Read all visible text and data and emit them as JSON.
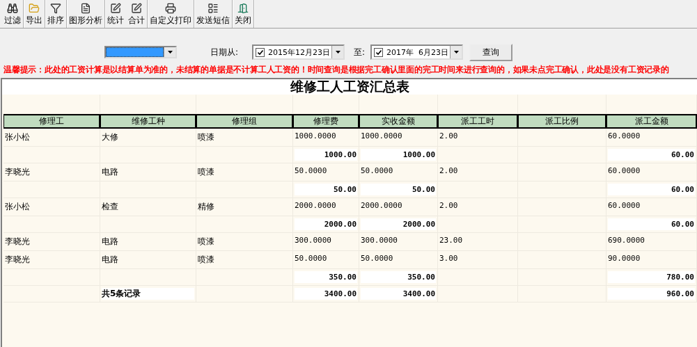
{
  "toolbar": [
    {
      "label": "过滤",
      "group_end": true
    },
    {
      "label": "导出",
      "group_end": true
    },
    {
      "label": "排序",
      "group_end": true
    },
    {
      "label": "图形分析",
      "group_end": true
    },
    {
      "label": "统计",
      "group_end": false
    },
    {
      "label": "合计",
      "group_end": true
    },
    {
      "label": "自定义打印",
      "group_end": true
    },
    {
      "label": "发送短信",
      "group_end": true
    },
    {
      "label": "关闭",
      "group_end": true
    }
  ],
  "filter": {
    "dropdown": {
      "selected": true
    },
    "date_label": "日期从:",
    "date_from": {
      "checked": true,
      "value": "2015年12月23日"
    },
    "to_label": "至:",
    "date_to": {
      "checked": true,
      "value": "2017年  6月23日"
    },
    "query_button": "查询"
  },
  "notice": "温馨提示：此处的工资计算是以结算单为准的，未结算的单据是不计算工人工资的！时间查询是根据完工确认里面的完工时间来进行查询的，如果未点完工确认，此处是没有工资记录的",
  "report": {
    "title": "维修工人工资汇总表",
    "columns": [
      "修理工",
      "维修工种",
      "修理组",
      "修理费",
      "实收金额",
      "派工工时",
      "派工比例",
      "派工金额"
    ],
    "rows": [
      {
        "kind": "detail",
        "worker": "张小松",
        "work_type": "大修",
        "group": "喷漆",
        "repair_fee": "1000.0000",
        "received_amount": "1000.0000",
        "dispatch_hours": "2.00",
        "dispatch_amount": "60.0000"
      },
      {
        "kind": "subtotal",
        "repair_fee": "1000.00",
        "received_amount": "1000.00",
        "dispatch_amount": "60.00"
      },
      {
        "kind": "detail",
        "worker": "李晓光",
        "work_type": "电路",
        "group": "喷漆",
        "repair_fee": "50.0000",
        "received_amount": "50.0000",
        "dispatch_hours": "2.00",
        "dispatch_amount": "60.0000"
      },
      {
        "kind": "subtotal",
        "repair_fee": "50.00",
        "received_amount": "50.00",
        "dispatch_amount": "60.00"
      },
      {
        "kind": "detail",
        "worker": "张小松",
        "work_type": "检查",
        "group": "精修",
        "repair_fee": "2000.0000",
        "received_amount": "2000.0000",
        "dispatch_hours": "2.00",
        "dispatch_amount": "60.0000"
      },
      {
        "kind": "subtotal",
        "repair_fee": "2000.00",
        "received_amount": "2000.00",
        "dispatch_amount": "60.00"
      },
      {
        "kind": "detail",
        "worker": "李晓光",
        "work_type": "电路",
        "group": "喷漆",
        "repair_fee": "300.0000",
        "received_amount": "300.0000",
        "dispatch_hours": "23.00",
        "dispatch_amount": "690.0000"
      },
      {
        "kind": "detail",
        "worker": "李晓光",
        "work_type": "电路",
        "group": "喷漆",
        "repair_fee": "50.0000",
        "received_amount": "50.0000",
        "dispatch_hours": "3.00",
        "dispatch_amount": "90.0000"
      },
      {
        "kind": "subtotal",
        "repair_fee": "350.00",
        "received_amount": "350.00",
        "dispatch_amount": "780.00"
      },
      {
        "kind": "total",
        "work_type": "共5条记录",
        "repair_fee": "3400.00",
        "received_amount": "3400.00",
        "dispatch_amount": "960.00"
      }
    ]
  }
}
